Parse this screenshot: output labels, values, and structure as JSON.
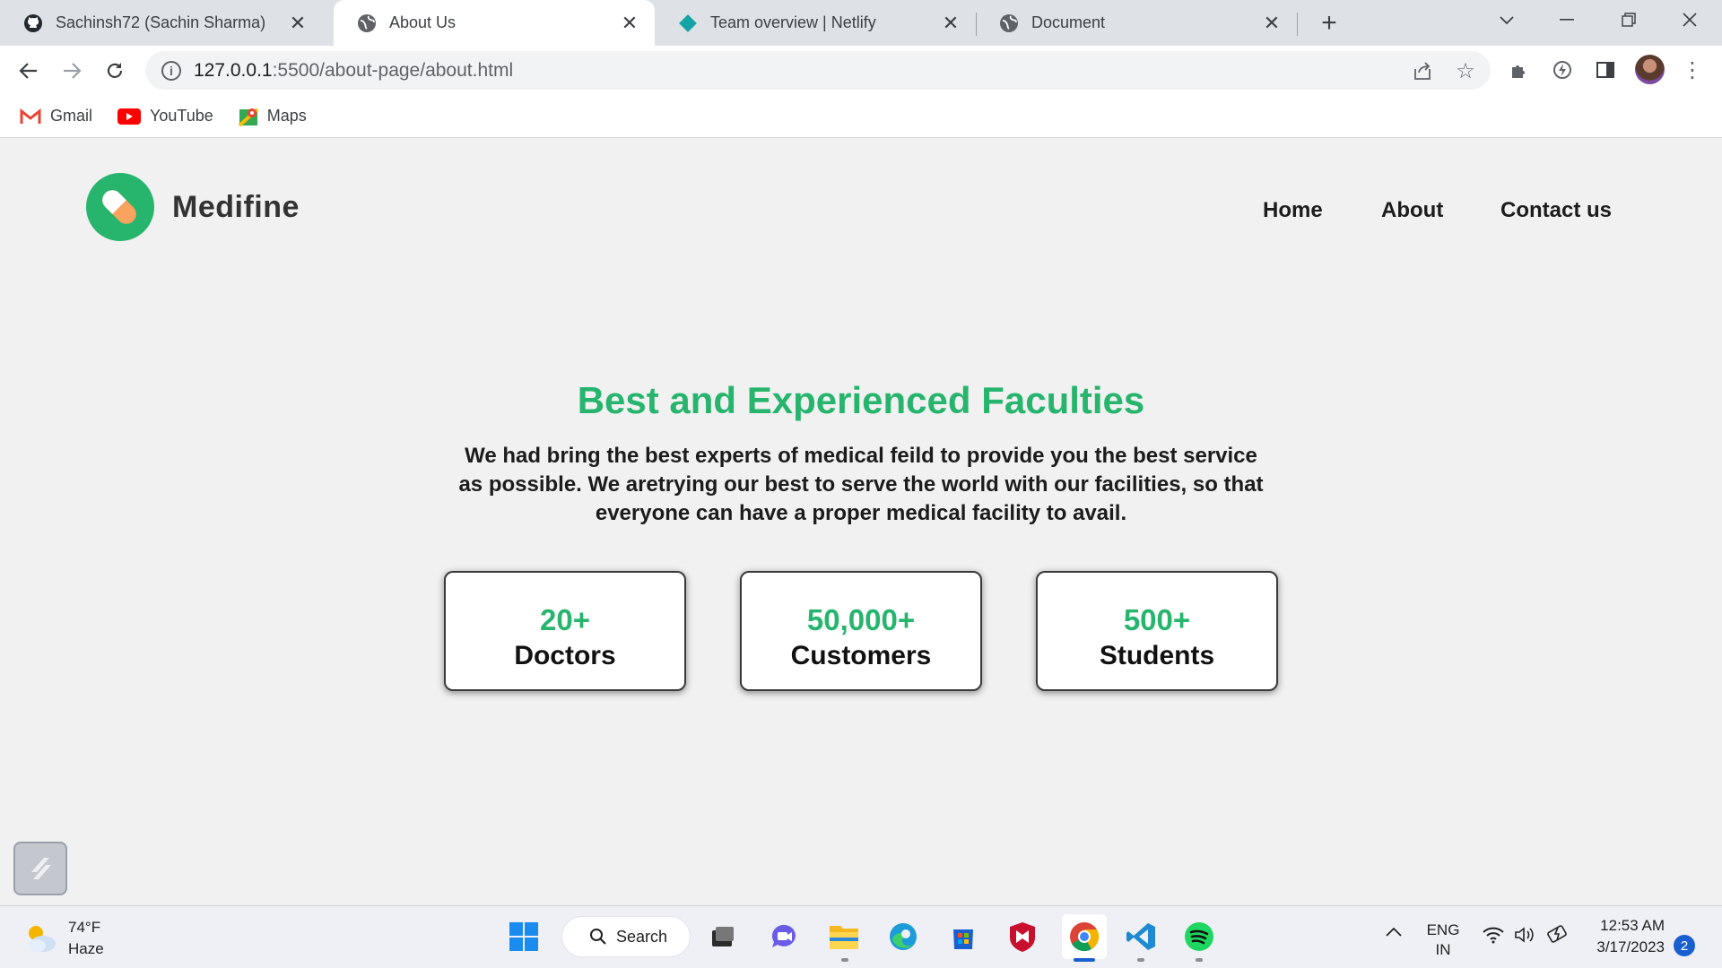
{
  "browser": {
    "tabs": [
      {
        "title": "Sachinsh72 (Sachin Sharma)",
        "icon": "github-icon",
        "active": false
      },
      {
        "title": "About Us",
        "icon": "globe-icon",
        "active": true
      },
      {
        "title": "Team overview | Netlify",
        "icon": "netlify-icon",
        "active": false
      },
      {
        "title": "Document",
        "icon": "globe-icon",
        "active": false
      }
    ],
    "url_host": "127.0.0.1",
    "url_path": ":5500/about-page/about.html",
    "bookmarks": [
      {
        "label": "Gmail",
        "icon": "gmail-icon"
      },
      {
        "label": "YouTube",
        "icon": "youtube-icon"
      },
      {
        "label": "Maps",
        "icon": "maps-icon"
      }
    ]
  },
  "site": {
    "brand": "Medifine",
    "nav": [
      "Home",
      "About",
      "Contact us"
    ],
    "headline": "Best and Experienced Faculties",
    "intro": "We had bring the best experts of medical feild to provide you the best service as possible. We aretrying our best to serve the world with our facilities, so that everyone can have a proper medical facility to avail.",
    "stats": [
      {
        "value": "20+",
        "label": "Doctors"
      },
      {
        "value": "50,000+",
        "label": "Customers"
      },
      {
        "value": "500+",
        "label": "Students"
      }
    ],
    "brand_color": "#27b56e"
  },
  "taskbar": {
    "weather_temp": "74°F",
    "weather_desc": "Haze",
    "search_label": "Search",
    "lang_top": "ENG",
    "lang_bottom": "IN",
    "time": "12:53 AM",
    "date": "3/17/2023",
    "notification_count": "2"
  }
}
